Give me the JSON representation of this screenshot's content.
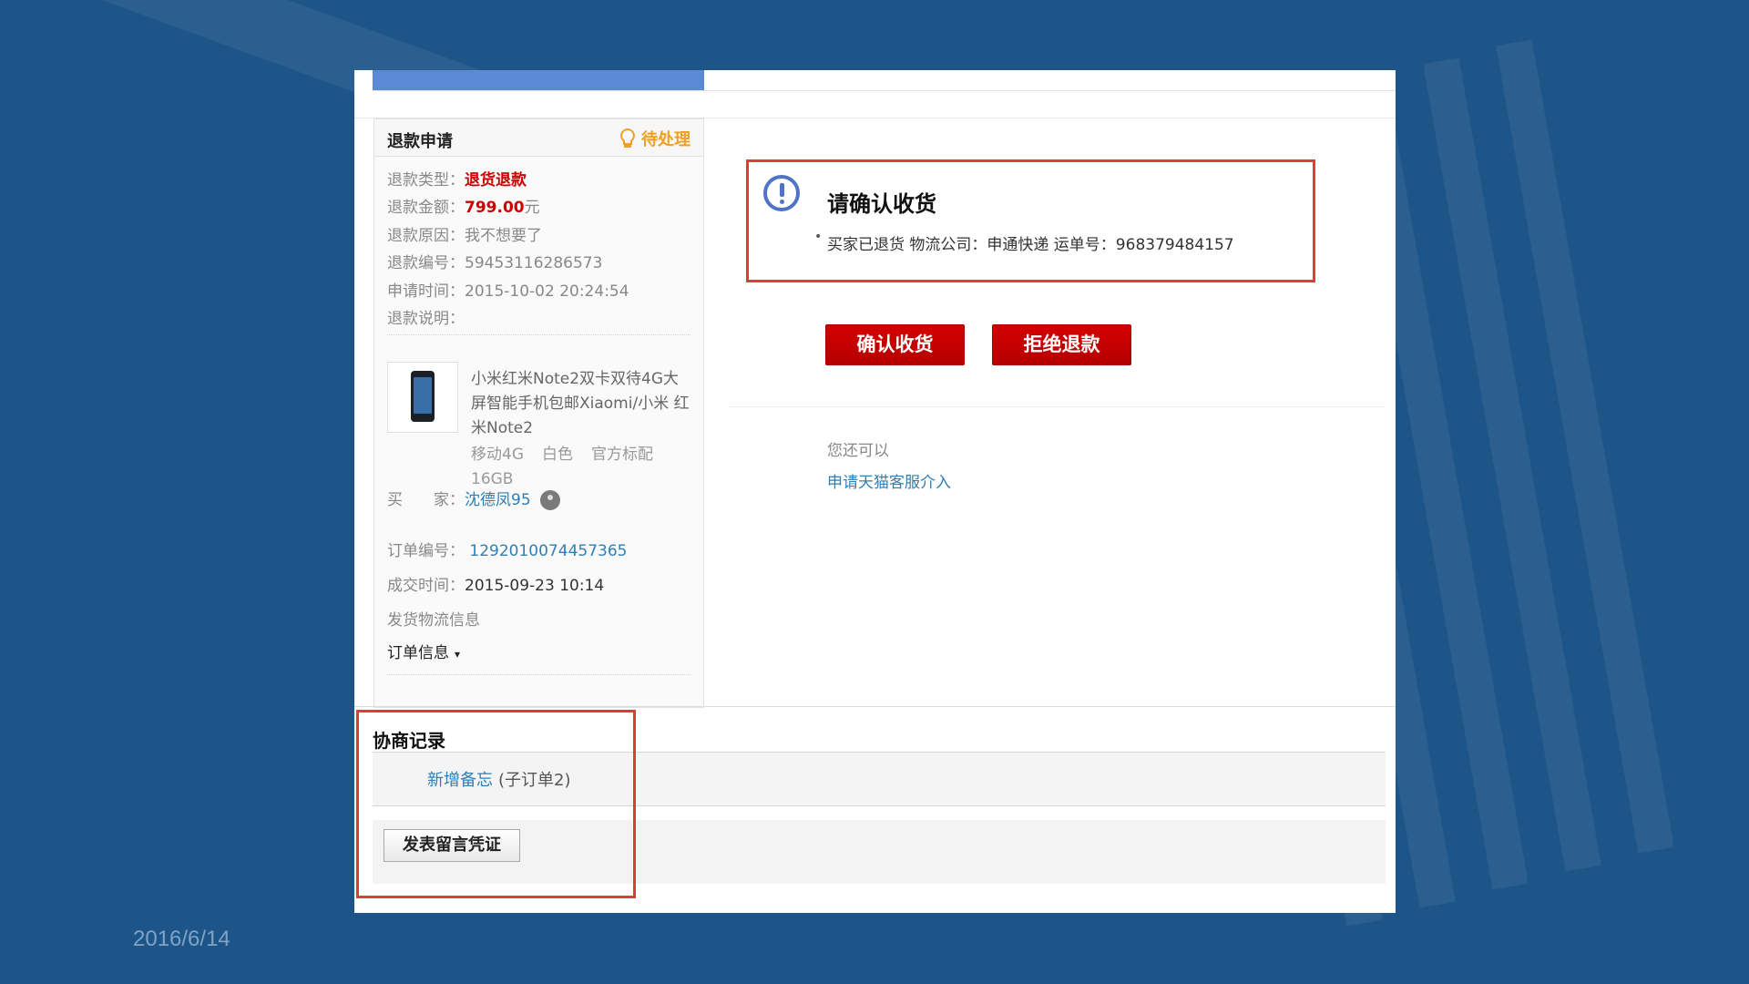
{
  "slide": {
    "date": "2016/6/14"
  },
  "left_panel": {
    "title": "退款申请",
    "status": "待处理",
    "rows": {
      "refund_type": {
        "label": "退款类型：",
        "value": "退货退款"
      },
      "refund_amount": {
        "label": "退款金额：",
        "value": "799.00",
        "unit": "元"
      },
      "refund_reason": {
        "label": "退款原因：",
        "value": "我不想要了"
      },
      "refund_number": {
        "label": "退款编号：",
        "value": "59453116286573"
      },
      "apply_time": {
        "label": "申请时间：",
        "value": "2015-10-02 20:24:54"
      },
      "refund_note": {
        "label": "退款说明：",
        "value": ""
      }
    },
    "product": {
      "title": "小米红米Note2双卡双待4G大屏智能手机包邮Xiaomi/小米 红米Note2",
      "specs": [
        "移动4G",
        "白色",
        "官方标配",
        "16GB"
      ]
    },
    "buyer": {
      "label": "买　　家：",
      "name": "沈德凤95"
    },
    "order_number": {
      "label": "订单编号：",
      "value": "1292010074457365"
    },
    "deal_time": {
      "label": "成交时间：",
      "value": "2015-09-23 10:14"
    },
    "logistics_label": "发货物流信息",
    "order_info_label": "订单信息"
  },
  "right_panel": {
    "alert_title": "请确认收货",
    "alert_detail": "买家已退货 物流公司：申通快递 运单号：968379484157",
    "confirm_button": "确认收货",
    "reject_button": "拒绝退款",
    "also_can": "您还可以",
    "tmall_link": "申请天猫客服介入"
  },
  "negotiation": {
    "title": "协商记录",
    "memo_link": "新增备忘",
    "memo_sub": "(子订单2)",
    "voucher_button": "发表留言凭证"
  },
  "colors": {
    "accent_red": "#c00000",
    "link_blue": "#2f7fb5",
    "status_orange": "#f0a020",
    "highlight_red": "#e03a3a"
  }
}
